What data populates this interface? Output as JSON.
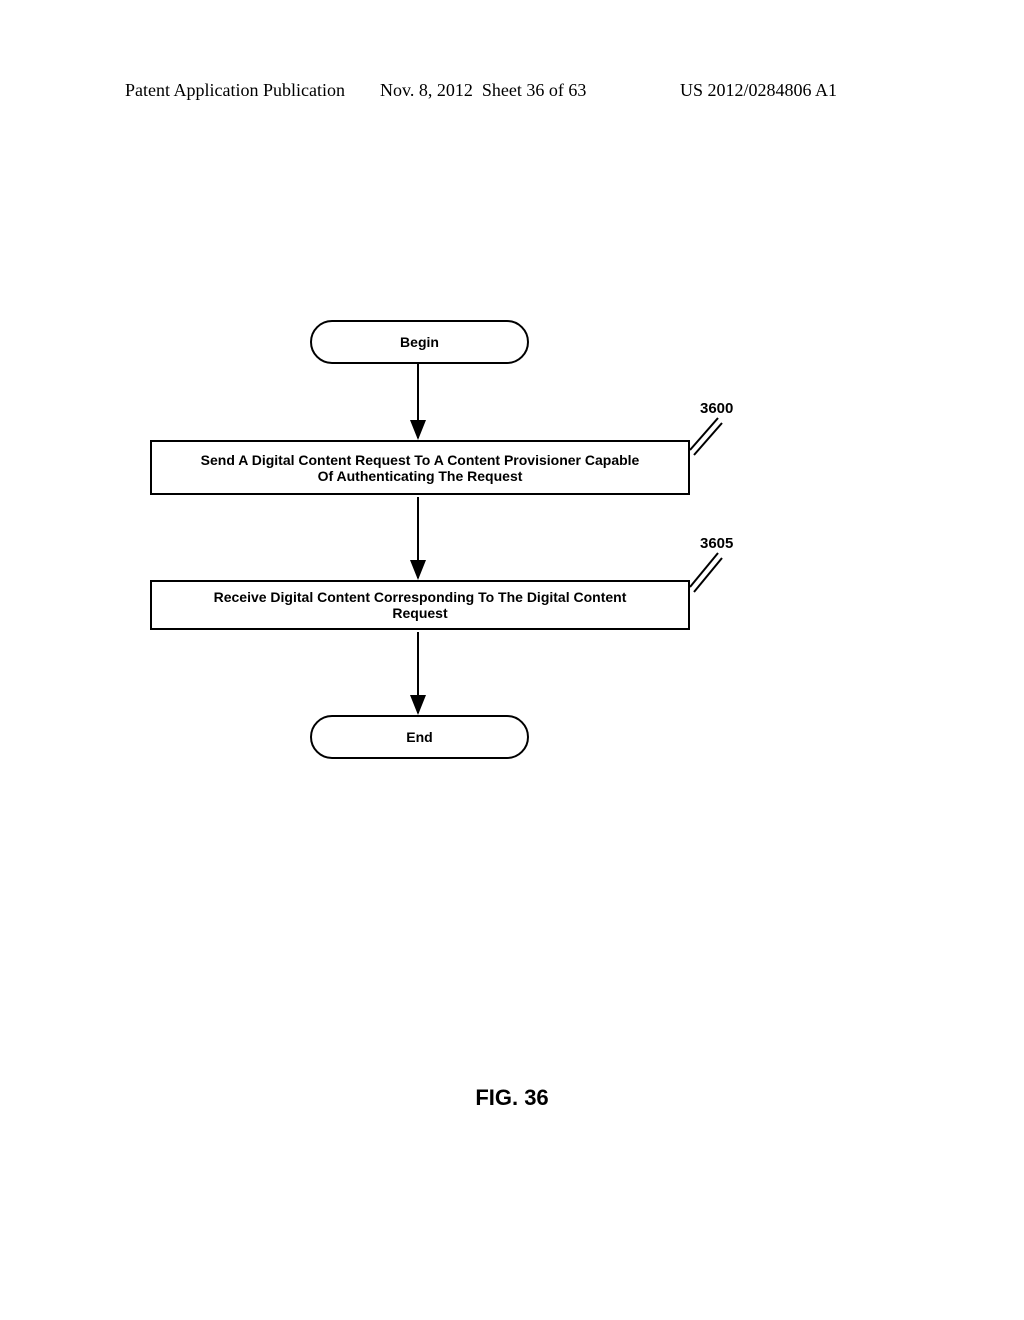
{
  "header": {
    "publication_label": "Patent Application Publication",
    "date": "Nov. 8, 2012",
    "sheet": "Sheet 36 of 63",
    "pub_number": "US 2012/0284806 A1"
  },
  "flowchart": {
    "begin": "Begin",
    "step1": {
      "text": "Send A Digital Content Request To A Content Provisioner Capable Of Authenticating The Request",
      "ref": "3600"
    },
    "step2": {
      "text": "Receive Digital Content Corresponding To The Digital Content Request",
      "ref": "3605"
    },
    "end": "End"
  },
  "figure_caption": "FIG. 36"
}
